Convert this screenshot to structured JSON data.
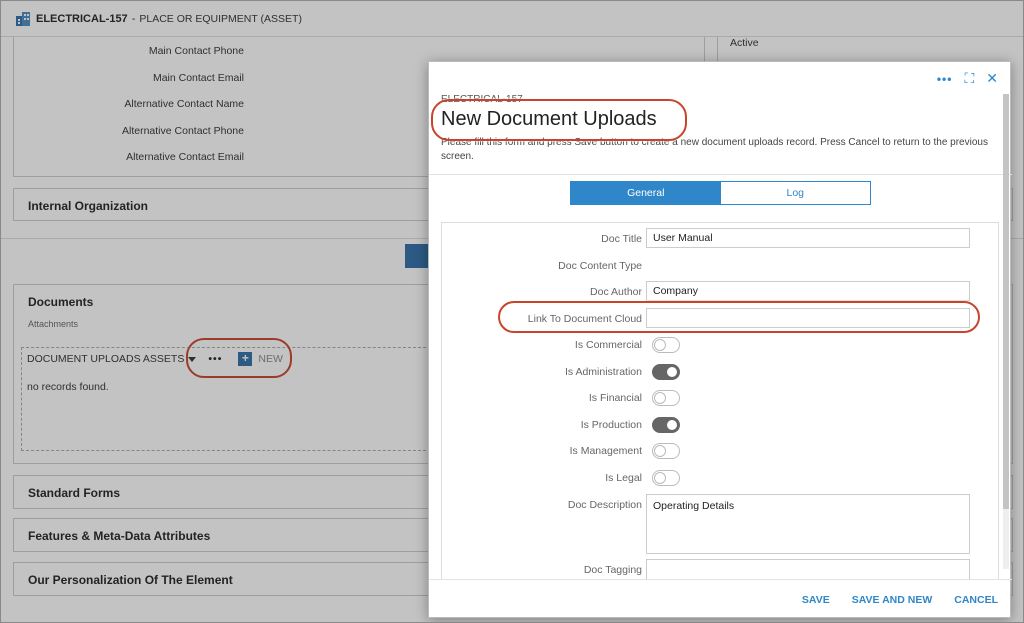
{
  "header": {
    "code": "ELECTRICAL-157",
    "separator": "-",
    "type": "PLACE OR EQUIPMENT (ASSET)"
  },
  "contact_fields": [
    "Main Contact Phone",
    "Main Contact Email",
    "Alternative Contact Name",
    "Alternative Contact Phone",
    "Alternative Contact Email"
  ],
  "status": "Active",
  "sections": {
    "internal_org": "Internal Organization",
    "documents": "Documents",
    "attachments": "Attachments",
    "standard_forms": "Standard Forms",
    "features": "Features & Meta-Data Attributes",
    "personalization": "Our Personalization Of The Element"
  },
  "documents_toolbar": {
    "dropdown": "DOCUMENT UPLOADS ASSETS",
    "more": "•••",
    "new_label": "NEW",
    "new_icon": "+",
    "empty": "no records found."
  },
  "modal": {
    "icons": {
      "more": "•••",
      "expand": "⛶",
      "close": "✕"
    },
    "subtitle": "ELECTRICAL-157",
    "title": "New Document Uploads",
    "description": "Please fill this form and press Save button to create a new document uploads record. Press Cancel to return to the previous screen.",
    "tabs": [
      "General",
      "Log"
    ],
    "fields": {
      "doc_title": {
        "label": "Doc Title",
        "value": "User Manual"
      },
      "doc_content_type": {
        "label": "Doc Content Type"
      },
      "doc_author": {
        "label": "Doc Author",
        "value": "Company"
      },
      "link_cloud": {
        "label": "Link To Document Cloud",
        "value": ""
      },
      "is_commercial": {
        "label": "Is Commercial",
        "on": false
      },
      "is_administration": {
        "label": "Is Administration",
        "on": true
      },
      "is_financial": {
        "label": "Is Financial",
        "on": false
      },
      "is_production": {
        "label": "Is Production",
        "on": true
      },
      "is_management": {
        "label": "Is Management",
        "on": false
      },
      "is_legal": {
        "label": "Is Legal",
        "on": false
      },
      "doc_description": {
        "label": "Doc Description",
        "value": "Operating Details"
      },
      "doc_tagging": {
        "label": "Doc Tagging",
        "value": ""
      }
    },
    "footer": {
      "save": "SAVE",
      "save_new": "SAVE AND NEW",
      "cancel": "CANCEL"
    }
  },
  "colors": {
    "accent": "#2f86c8",
    "highlight": "#c8452c",
    "toggle_on": "#666666"
  }
}
